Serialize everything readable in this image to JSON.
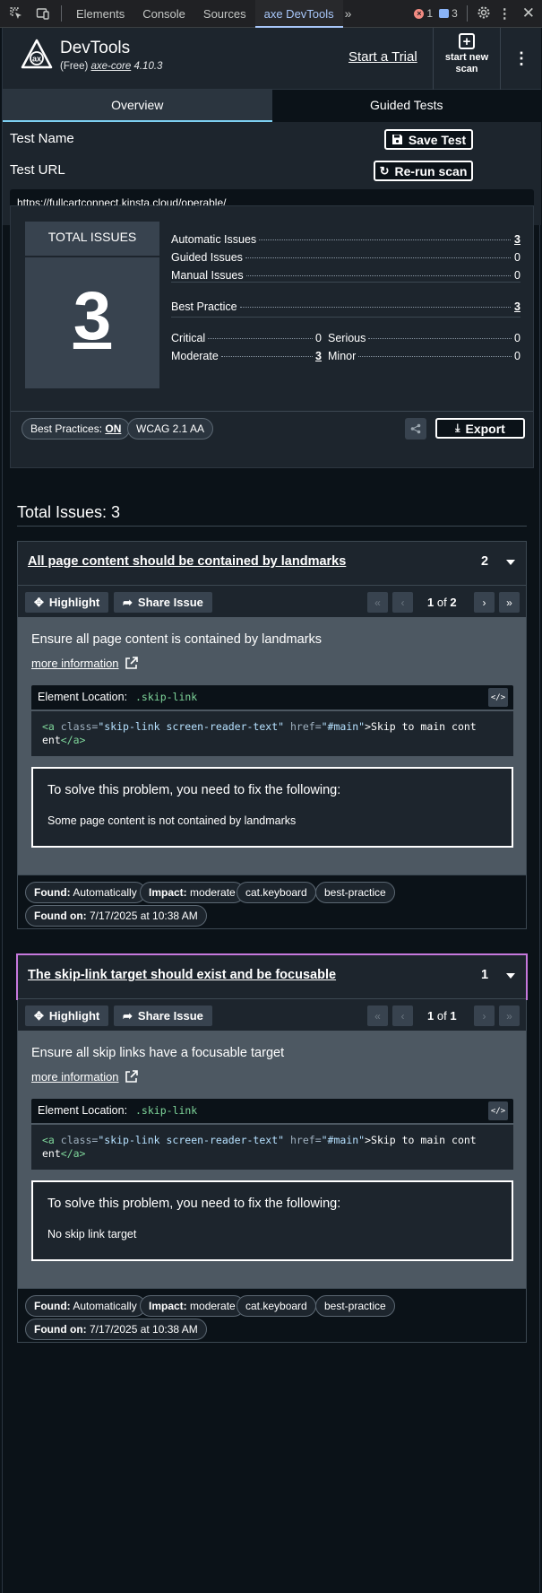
{
  "devtools": {
    "tabs": [
      "Elements",
      "Console",
      "Sources",
      "axe DevTools"
    ],
    "active_tab": "axe DevTools",
    "more_tabs": "»",
    "error_count": "1",
    "message_count": "3"
  },
  "header": {
    "title": "DevTools",
    "subtitle_prefix": "(Free)",
    "subtitle_link": "axe-core",
    "version": "4.10.3",
    "trial_link": "Start a Trial",
    "new_scan_line1": "start new",
    "new_scan_line2": "scan"
  },
  "tabs": {
    "overview": "Overview",
    "guided": "Guided Tests"
  },
  "test": {
    "name_label": "Test Name",
    "save_label": "Save Test",
    "url_label": "Test URL",
    "rerun_label": "Re-run scan",
    "url": "https://fullcartconnect.kinsta.cloud/operable/"
  },
  "summary": {
    "total_title": "TOTAL ISSUES",
    "total_value": "3",
    "automatic_label": "Automatic Issues",
    "automatic_value": "3",
    "guided_label": "Guided Issues",
    "guided_value": "0",
    "manual_label": "Manual Issues",
    "manual_value": "0",
    "best_label": "Best Practice",
    "best_value": "3",
    "critical_label": "Critical",
    "critical_value": "0",
    "serious_label": "Serious",
    "serious_value": "0",
    "moderate_label": "Moderate",
    "moderate_value": "3",
    "minor_label": "Minor",
    "minor_value": "0",
    "best_practices_toggle_label": "Best Practices:",
    "best_practices_toggle_value": "ON",
    "standard": "WCAG 2.1 AA",
    "export_label": "Export"
  },
  "issues_heading": "Total Issues: 3",
  "issues": [
    {
      "title": "All page content should be contained by landmarks",
      "count": "2",
      "highlight_label": "Highlight",
      "share_label": "Share Issue",
      "page_current": "1",
      "page_of": "of",
      "page_total": "2",
      "description": "Ensure all page content is contained by landmarks",
      "more_info": "more information",
      "location_label": "Element Location:",
      "location_selector": ".skip-link",
      "code_tag_open": "<a",
      "code_attr_class": "class=",
      "code_class_value": "\"skip-link screen-reader-text\"",
      "code_attr_href": "href=",
      "code_href_value": "\"#main\"",
      "code_text": ">Skip to main cont",
      "code_text2": "ent",
      "code_tag_close": "</a>",
      "fix_heading": "To solve this problem, you need to fix the following:",
      "fix_detail": "Some page content is not contained by landmarks",
      "found_label": "Found:",
      "found_value": "Automatically",
      "impact_label": "Impact:",
      "impact_value": "moderate",
      "tag1": "cat.keyboard",
      "tag2": "best-practice",
      "found_on_label": "Found on:",
      "found_on_value": "7/17/2025 at 10:38 AM"
    },
    {
      "title": "The skip-link target should exist and be focusable",
      "count": "1",
      "highlight_label": "Highlight",
      "share_label": "Share Issue",
      "page_current": "1",
      "page_of": "of",
      "page_total": "1",
      "description": "Ensure all skip links have a focusable target",
      "more_info": "more information",
      "location_label": "Element Location:",
      "location_selector": ".skip-link",
      "code_tag_open": "<a",
      "code_attr_class": "class=",
      "code_class_value": "\"skip-link screen-reader-text\"",
      "code_attr_href": "href=",
      "code_href_value": "\"#main\"",
      "code_text": ">Skip to main cont",
      "code_text2": "ent",
      "code_tag_close": "</a>",
      "fix_heading": "To solve this problem, you need to fix the following:",
      "fix_detail": "No skip link target",
      "found_label": "Found:",
      "found_value": "Automatically",
      "impact_label": "Impact:",
      "impact_value": "moderate",
      "tag1": "cat.keyboard",
      "tag2": "best-practice",
      "found_on_label": "Found on:",
      "found_on_value": "7/17/2025 at 10:38 AM"
    }
  ]
}
